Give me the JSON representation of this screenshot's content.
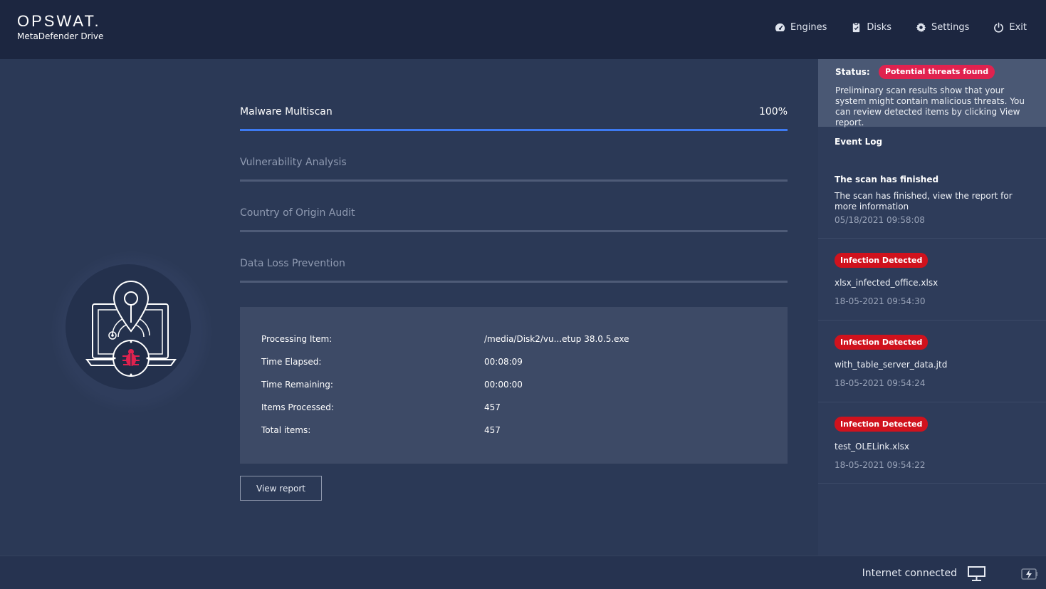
{
  "header": {
    "logo": "OPSWAT.",
    "product": "MetaDefender Drive",
    "nav": [
      {
        "label": "Engines",
        "icon": "gauge-icon"
      },
      {
        "label": "Disks",
        "icon": "clipboard-check-icon"
      },
      {
        "label": "Settings",
        "icon": "gear-icon"
      },
      {
        "label": "Exit",
        "icon": "power-icon"
      }
    ]
  },
  "steps": [
    {
      "label": "Malware Multiscan",
      "progress_text": "100%",
      "progress": 1.0,
      "active": true
    },
    {
      "label": "Vulnerability Analysis",
      "progress": 0,
      "active": false
    },
    {
      "label": "Country of Origin Audit",
      "progress": 0,
      "active": false
    },
    {
      "label": "Data Loss Prevention",
      "progress": 0,
      "active": false
    }
  ],
  "details": [
    {
      "key": "Processing Item:",
      "value": "/media/Disk2/vu...etup 38.0.5.exe"
    },
    {
      "key": "Time Elapsed:",
      "value": "00:08:09"
    },
    {
      "key": "Time Remaining:",
      "value": "00:00:00"
    },
    {
      "key": "Items Processed:",
      "value": "457"
    },
    {
      "key": "Total items:",
      "value": "457"
    }
  ],
  "view_report_label": "View report",
  "sidebar": {
    "status_label": "Status:",
    "status_badge": "Potential threats found",
    "status_text": "Preliminary scan results show that your system might contain malicious threats. You can review detected items by clicking View report.",
    "event_log_title": "Event Log",
    "finished": {
      "title": "The scan has finished",
      "text": "The scan has finished, view the report for more information",
      "time": "05/18/2021 09:58:08"
    },
    "infections": [
      {
        "badge": "Infection Detected",
        "file": "xlsx_infected_office.xlsx",
        "time": "18-05-2021 09:54:30"
      },
      {
        "badge": "Infection Detected",
        "file": "with_table_server_data.jtd",
        "time": "18-05-2021 09:54:24"
      },
      {
        "badge": "Infection Detected",
        "file": "test_OLELink.xlsx",
        "time": "18-05-2021 09:54:22"
      }
    ]
  },
  "footer": {
    "internet_status": "Internet connected"
  },
  "colors": {
    "accent": "#3d7af2",
    "threat_badge": "#e0224f",
    "infection_badge": "#d0121d",
    "bug": "#e0224f"
  }
}
